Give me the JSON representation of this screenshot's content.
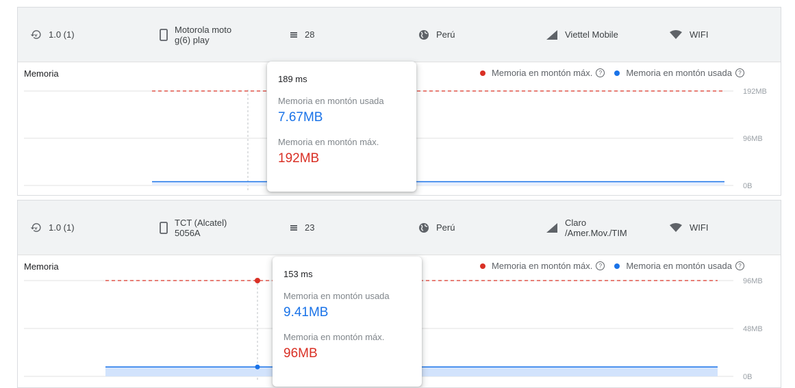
{
  "colors": {
    "max": "#d93025",
    "used": "#1a73e8",
    "used_fill": "#d2e3fc",
    "grid": "#e0e0e0"
  },
  "panels": [
    {
      "info": {
        "version": "1.0 (1)",
        "device_line1": "Motorola moto",
        "device_line2": "g(6) play",
        "api_level": "28",
        "country": "Perú",
        "carrier_line1": "Viettel Mobile",
        "carrier_line2": "",
        "network": "WIFI"
      },
      "chart_title": "Memoria",
      "legend": {
        "max_label": "Memoria en montón máx.",
        "used_label": "Memoria en montón usada"
      },
      "tooltip": {
        "time": "189 ms",
        "used_label": "Memoria en montón usada",
        "used_value": "7.67MB",
        "max_label": "Memoria en montón máx.",
        "max_value": "192MB"
      },
      "chart_data": {
        "type": "line",
        "y_ticks": [
          "192MB",
          "96MB",
          "0B"
        ],
        "ylim": [
          0,
          192
        ],
        "y_unit": "MB",
        "grid": true,
        "legend_position": "top-right",
        "series": [
          {
            "name": "Memoria en montón máx.",
            "values": [
              192,
              192
            ]
          },
          {
            "name": "Memoria en montón usada",
            "values": [
              7.67,
              7.67
            ]
          }
        ],
        "highlight_time": "189 ms"
      }
    },
    {
      "info": {
        "version": "1.0 (1)",
        "device_line1": "TCT (Alcatel)",
        "device_line2": "5056A",
        "api_level": "23",
        "country": "Perú",
        "carrier_line1": "Claro",
        "carrier_line2": "/Amer.Mov./TIM",
        "network": "WIFI"
      },
      "chart_title": "Memoria",
      "legend": {
        "max_label": "Memoria en montón máx.",
        "used_label": "Memoria en montón usada"
      },
      "tooltip": {
        "time": "153 ms",
        "used_label": "Memoria en montón usada",
        "used_value": "9.41MB",
        "max_label": "Memoria en montón máx.",
        "max_value": "96MB"
      },
      "chart_data": {
        "type": "area",
        "y_ticks": [
          "96MB",
          "48MB",
          "0B"
        ],
        "ylim": [
          0,
          96
        ],
        "y_unit": "MB",
        "grid": true,
        "legend_position": "top-right",
        "series": [
          {
            "name": "Memoria en montón máx.",
            "values": [
              96,
              96
            ]
          },
          {
            "name": "Memoria en montón usada",
            "values": [
              9.41,
              9.41
            ]
          }
        ],
        "highlight_time": "153 ms"
      }
    }
  ]
}
